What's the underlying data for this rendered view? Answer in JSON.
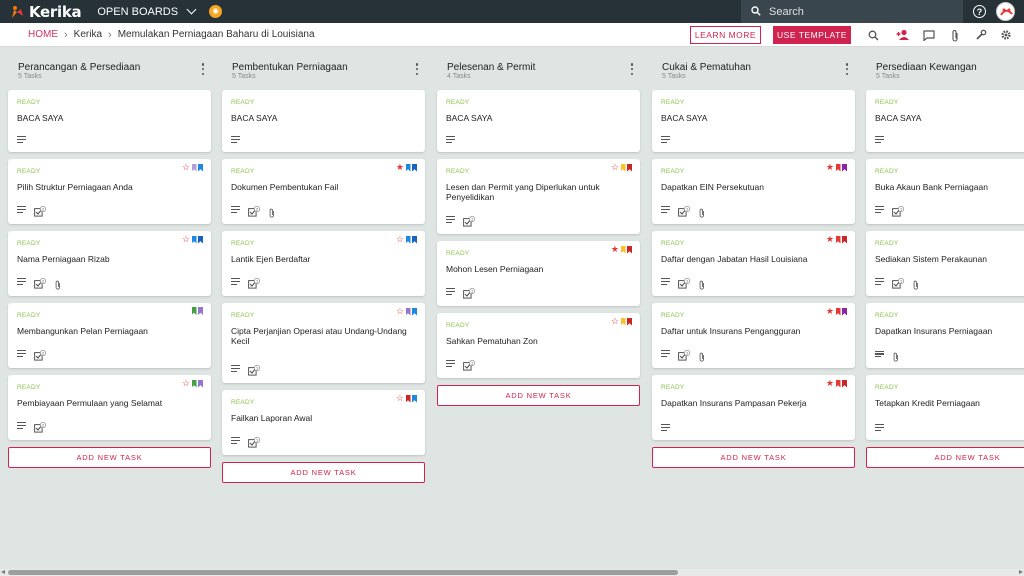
{
  "app": {
    "name": "Kerika",
    "open_boards": "OPEN BOARDS"
  },
  "search": {
    "placeholder": "Search"
  },
  "breadcrumb": {
    "home": "HOME",
    "org": "Kerika",
    "board": "Memulakan Perniagaan Baharu di Louisiana"
  },
  "toolbar": {
    "learn_more": "LEARN MORE",
    "use_template": "USE TEMPLATE"
  },
  "colors": {
    "accent": "#d0234f",
    "ready": "#8bc34a",
    "topbar": "#263238",
    "background": "#dfe5e3"
  },
  "columns": [
    {
      "title": "Perancangan & Persediaan",
      "count": "5 Tasks",
      "cards": [
        {
          "status": "READY",
          "title": "BACA SAYA",
          "star": "none",
          "flags": [],
          "task_count": null,
          "attachment": false
        },
        {
          "status": "READY",
          "title": "Pilih Struktur Perniagaan Anda",
          "star": "outline",
          "flags": [
            "#b39ddb",
            "#1e88e5"
          ],
          "task_count": "2",
          "attachment": false
        },
        {
          "status": "READY",
          "title": "Nama Perniagaan Rizab",
          "star": "outline",
          "flags": [
            "#1e88e5",
            "#1565c0"
          ],
          "task_count": "2",
          "attachment": true
        },
        {
          "status": "READY",
          "title": "Membangunkan Pelan Perniagaan",
          "star": "none",
          "flags": [
            "#43a047",
            "#9575cd"
          ],
          "task_count": "2",
          "attachment": false
        },
        {
          "status": "READY",
          "title": "Pembiayaan Permulaan yang Selamat",
          "star": "outline",
          "flags": [
            "#43a047",
            "#9575cd"
          ],
          "task_count": "2",
          "attachment": false
        }
      ],
      "add_label": "ADD NEW TASK"
    },
    {
      "title": "Pembentukan Perniagaan",
      "count": "5 Tasks",
      "cards": [
        {
          "status": "READY",
          "title": "BACA SAYA",
          "star": "none",
          "flags": [],
          "task_count": null,
          "attachment": false
        },
        {
          "status": "READY",
          "title": "Dokumen Pembentukan Fail",
          "star": "filled",
          "flags": [
            "#1e88e5",
            "#1565c0"
          ],
          "task_count": "2",
          "attachment": true
        },
        {
          "status": "READY",
          "title": "Lantik Ejen Berdaftar",
          "star": "outline",
          "flags": [
            "#1e88e5",
            "#1565c0"
          ],
          "task_count": "1",
          "attachment": false
        },
        {
          "status": "READY",
          "title": "Cipta Perjanjian Operasi atau Undang-Undang Kecil",
          "star": "outline",
          "flags": [
            "#9575cd",
            "#1e88e5"
          ],
          "task_count": "1",
          "attachment": false
        },
        {
          "status": "READY",
          "title": "Failkan Laporan Awal",
          "star": "outline",
          "flags": [
            "#c62828",
            "#1e88e5"
          ],
          "task_count": "1",
          "attachment": false
        }
      ],
      "add_label": "ADD NEW TASK"
    },
    {
      "title": "Pelesenan & Permit",
      "count": "4 Tasks",
      "cards": [
        {
          "status": "READY",
          "title": "BACA SAYA",
          "star": "none",
          "flags": [],
          "task_count": null,
          "attachment": false
        },
        {
          "status": "READY",
          "title": "Lesen dan Permit yang Diperlukan untuk Penyelidikan",
          "star": "outline",
          "flags": [
            "#fbc02d",
            "#c62828"
          ],
          "task_count": "1",
          "attachment": false
        },
        {
          "status": "READY",
          "title": "Mohon Lesen Perniagaan",
          "star": "filled",
          "flags": [
            "#fbc02d",
            "#c62828"
          ],
          "task_count": "1",
          "attachment": false
        },
        {
          "status": "READY",
          "title": "Sahkan Pematuhan Zon",
          "star": "outline",
          "flags": [
            "#fbc02d",
            "#c62828"
          ],
          "task_count": "1",
          "attachment": false
        }
      ],
      "add_label": "ADD NEW TASK"
    },
    {
      "title": "Cukai & Pematuhan",
      "count": "5 Tasks",
      "cards": [
        {
          "status": "READY",
          "title": "BACA SAYA",
          "star": "none",
          "flags": [],
          "task_count": null,
          "attachment": false
        },
        {
          "status": "READY",
          "title": "Dapatkan EIN Persekutuan",
          "star": "filled",
          "flags": [
            "#e53935",
            "#8e24aa"
          ],
          "task_count": "1",
          "attachment": true
        },
        {
          "status": "READY",
          "title": "Daftar dengan Jabatan Hasil Louisiana",
          "star": "filled",
          "flags": [
            "#e53935",
            "#c62828"
          ],
          "task_count": "1",
          "attachment": true
        },
        {
          "status": "READY",
          "title": "Daftar untuk Insurans Pengangguran",
          "star": "filled",
          "flags": [
            "#e53935",
            "#8e24aa"
          ],
          "task_count": "1",
          "attachment": true
        },
        {
          "status": "READY",
          "title": "Dapatkan Insurans Pampasan Pekerja",
          "star": "filled",
          "flags": [
            "#e53935",
            "#c62828"
          ],
          "task_count": null,
          "attachment": false
        }
      ],
      "add_label": "ADD NEW TASK"
    },
    {
      "title": "Persediaan Kewangan",
      "count": "5 Tasks",
      "cards": [
        {
          "status": "READY",
          "title": "BACA SAYA",
          "star": "none",
          "flags": [],
          "task_count": null,
          "attachment": false
        },
        {
          "status": "READY",
          "title": "Buka Akaun Bank Perniagaan",
          "star": "none",
          "flags": [],
          "task_count": "1",
          "attachment": false
        },
        {
          "status": "READY",
          "title": "Sediakan Sistem Perakaunan",
          "star": "none",
          "flags": [],
          "task_count": "1",
          "attachment": true
        },
        {
          "status": "READY",
          "title": "Dapatkan Insurans Perniagaan",
          "star": "none",
          "flags": [],
          "task_count": null,
          "attachment": true
        },
        {
          "status": "READY",
          "title": "Tetapkan Kredit Perniagaan",
          "star": "none",
          "flags": [],
          "task_count": null,
          "attachment": false
        }
      ],
      "add_label": "ADD NEW TASK"
    }
  ]
}
